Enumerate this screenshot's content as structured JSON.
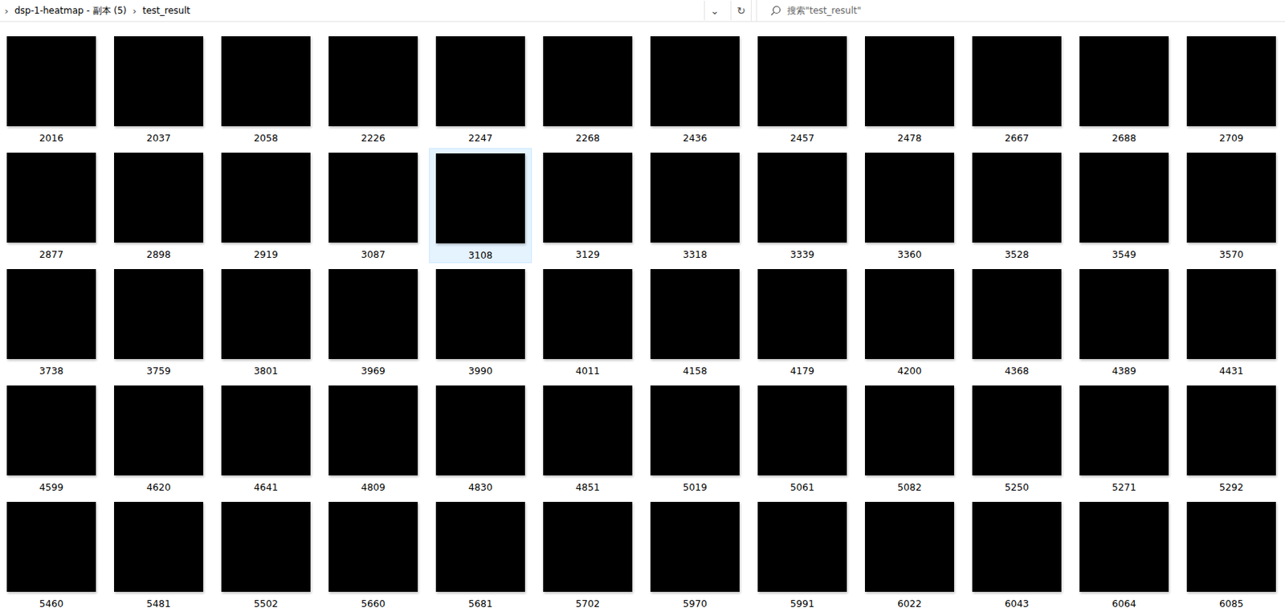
{
  "window": {
    "title": "test_result"
  },
  "address_bar": {
    "separator": "›",
    "path": [
      "dsp-1-heatmap - 副本 (5)",
      "test_result"
    ],
    "dropdown": "⌄",
    "refresh": "↻"
  },
  "search": {
    "placeholder": "搜索\"test_result\""
  },
  "files": [
    {
      "name": "2016",
      "selected": false
    },
    {
      "name": "2037",
      "selected": false
    },
    {
      "name": "2058",
      "selected": false
    },
    {
      "name": "2226",
      "selected": false
    },
    {
      "name": "2247",
      "selected": false
    },
    {
      "name": "2268",
      "selected": false
    },
    {
      "name": "2436",
      "selected": false
    },
    {
      "name": "2457",
      "selected": false
    },
    {
      "name": "2478",
      "selected": false
    },
    {
      "name": "2667",
      "selected": false
    },
    {
      "name": "2688",
      "selected": false
    },
    {
      "name": "2709",
      "selected": false
    },
    {
      "name": "2877",
      "selected": false
    },
    {
      "name": "2898",
      "selected": false
    },
    {
      "name": "2919",
      "selected": false
    },
    {
      "name": "3087",
      "selected": false
    },
    {
      "name": "3108",
      "selected": true
    },
    {
      "name": "3129",
      "selected": false
    },
    {
      "name": "3318",
      "selected": false
    },
    {
      "name": "3339",
      "selected": false
    },
    {
      "name": "3360",
      "selected": false
    },
    {
      "name": "3528",
      "selected": false
    },
    {
      "name": "3549",
      "selected": false
    },
    {
      "name": "3570",
      "selected": false
    },
    {
      "name": "3738",
      "selected": false
    },
    {
      "name": "3759",
      "selected": false
    },
    {
      "name": "3801",
      "selected": false
    },
    {
      "name": "3969",
      "selected": false
    },
    {
      "name": "3990",
      "selected": false
    },
    {
      "name": "4011",
      "selected": false
    },
    {
      "name": "4158",
      "selected": false
    },
    {
      "name": "4179",
      "selected": false
    },
    {
      "name": "4200",
      "selected": false
    },
    {
      "name": "4368",
      "selected": false
    },
    {
      "name": "4389",
      "selected": false
    },
    {
      "name": "4431",
      "selected": false
    },
    {
      "name": "4599",
      "selected": false
    },
    {
      "name": "4620",
      "selected": false
    },
    {
      "name": "4641",
      "selected": false
    },
    {
      "name": "4809",
      "selected": false
    },
    {
      "name": "4830",
      "selected": false
    },
    {
      "name": "4851",
      "selected": false
    },
    {
      "name": "5019",
      "selected": false
    },
    {
      "name": "5061",
      "selected": false
    },
    {
      "name": "5082",
      "selected": false
    },
    {
      "name": "5250",
      "selected": false
    },
    {
      "name": "5271",
      "selected": false
    },
    {
      "name": "5292",
      "selected": false
    },
    {
      "name": "5460",
      "selected": false
    },
    {
      "name": "5481",
      "selected": false
    },
    {
      "name": "5502",
      "selected": false
    },
    {
      "name": "5660",
      "selected": false
    },
    {
      "name": "5681",
      "selected": false
    },
    {
      "name": "5702",
      "selected": false
    },
    {
      "name": "5970",
      "selected": false
    },
    {
      "name": "5991",
      "selected": false
    },
    {
      "name": "6022",
      "selected": false
    },
    {
      "name": "6043",
      "selected": false
    },
    {
      "name": "6064",
      "selected": false
    },
    {
      "name": "6085",
      "selected": false
    }
  ]
}
